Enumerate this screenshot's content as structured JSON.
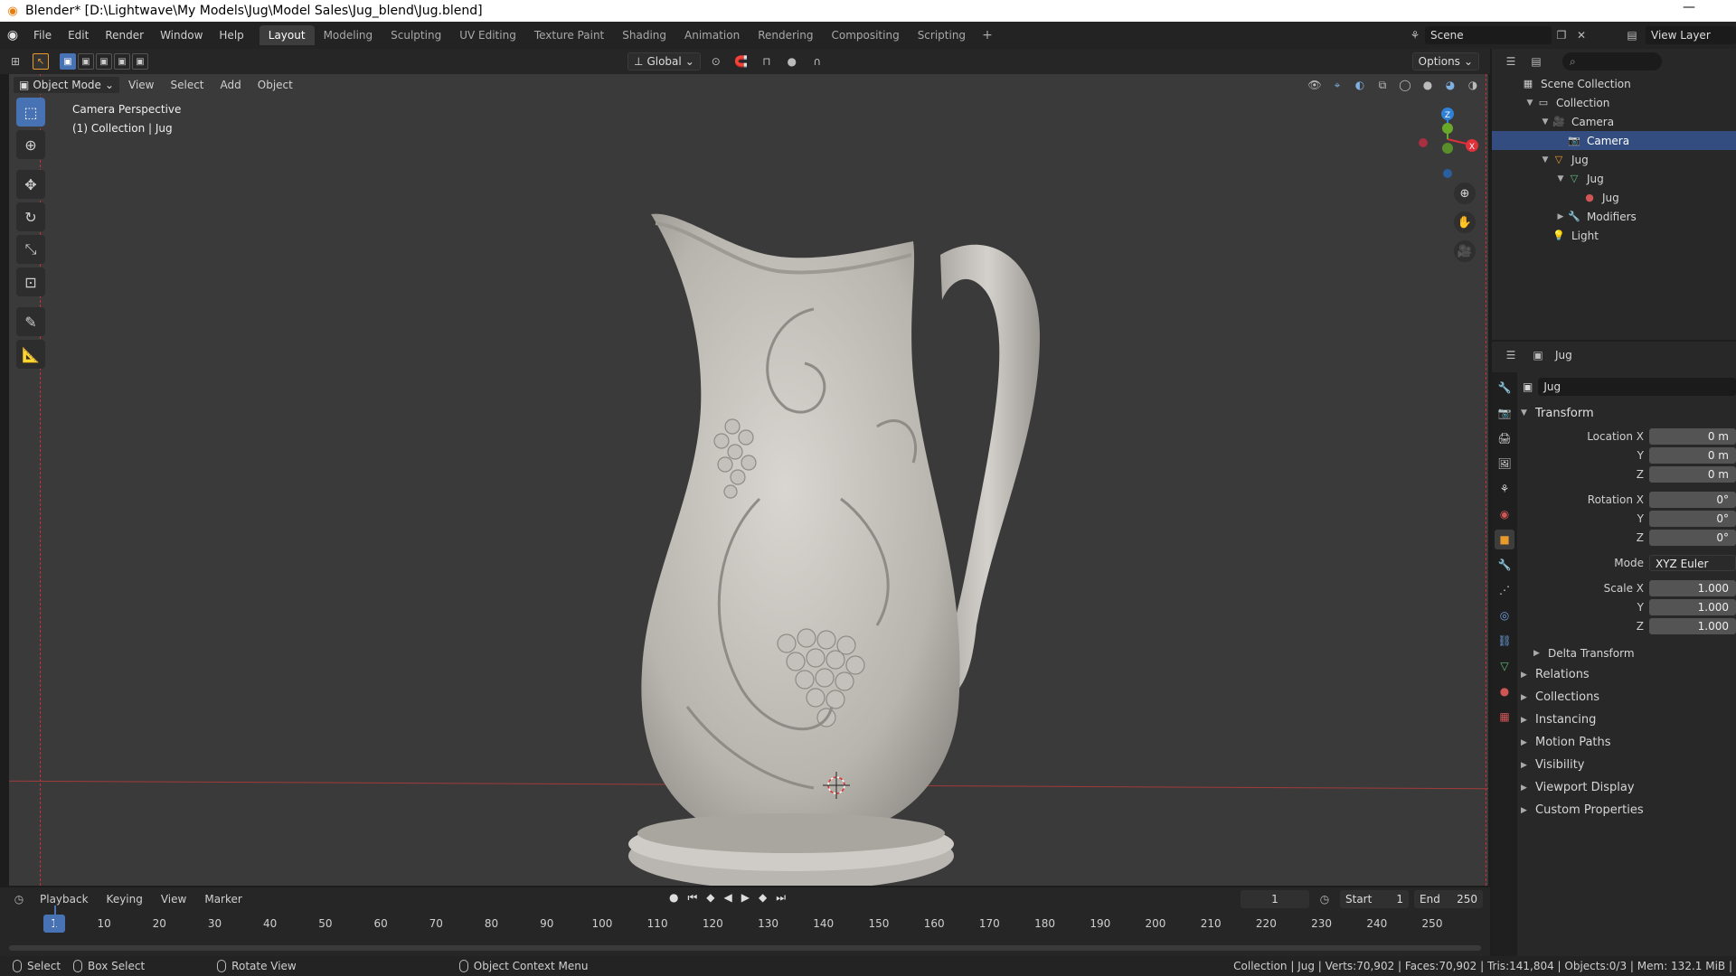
{
  "titlebar": {
    "title": "Blender* [D:\\Lightwave\\My Models\\Jug\\Model Sales\\Jug_blend\\Jug.blend]",
    "minimize": "—"
  },
  "menu": [
    "File",
    "Edit",
    "Render",
    "Window",
    "Help"
  ],
  "workspaces": [
    {
      "label": "Layout",
      "active": true
    },
    {
      "label": "Modeling"
    },
    {
      "label": "Sculpting"
    },
    {
      "label": "UV Editing"
    },
    {
      "label": "Texture Paint"
    },
    {
      "label": "Shading"
    },
    {
      "label": "Animation"
    },
    {
      "label": "Rendering"
    },
    {
      "label": "Compositing"
    },
    {
      "label": "Scripting"
    }
  ],
  "workspace_add": "+",
  "scene": {
    "label": "Scene",
    "view_layer": "View Layer"
  },
  "header2": {
    "orientation": "Global",
    "options": "Options"
  },
  "viewport": {
    "mode": "Object Mode",
    "menus": [
      "View",
      "Select",
      "Add",
      "Object"
    ],
    "overlay_line1": "Camera Perspective",
    "overlay_line2": "(1) Collection | Jug",
    "gizmo": {
      "x": "X",
      "y": "Y",
      "z": "Z"
    }
  },
  "timeline": {
    "menus": [
      "Playback",
      "Keying",
      "View",
      "Marker"
    ],
    "current_frame": "1",
    "start_label": "Start",
    "start": "1",
    "end_label": "End",
    "end": "250",
    "ticks": [
      "10",
      "20",
      "30",
      "40",
      "50",
      "60",
      "70",
      "80",
      "90",
      "100",
      "110",
      "120",
      "130",
      "140",
      "150",
      "160",
      "170",
      "180",
      "190",
      "200",
      "210",
      "220",
      "230",
      "240",
      "250"
    ],
    "cur": "1"
  },
  "statusbar": {
    "select": "Select",
    "box_select": "Box Select",
    "rotate": "Rotate View",
    "context": "Object Context Menu",
    "stats": "Collection | Jug | Verts:70,902 | Faces:70,902 | Tris:141,804 | Objects:0/3 | Mem: 132.1 MiB |"
  },
  "outliner": {
    "rows": [
      {
        "label": "Scene Collection",
        "indent": 0,
        "icon": "scene-collection-icon",
        "color": "#cfcfcf"
      },
      {
        "label": "Collection",
        "indent": 1,
        "icon": "collection-icon",
        "color": "#cfcfcf"
      },
      {
        "label": "Camera",
        "indent": 2,
        "icon": "camera-object-icon",
        "color": "#e89a2c"
      },
      {
        "label": "Camera",
        "indent": 3,
        "icon": "camera-data-icon",
        "color": "#7fb0e0",
        "selected": true
      },
      {
        "label": "Jug",
        "indent": 2,
        "icon": "mesh-object-icon",
        "color": "#e89a2c"
      },
      {
        "label": "Jug",
        "indent": 3,
        "icon": "mesh-data-icon",
        "color": "#5fbf7f"
      },
      {
        "label": "Jug",
        "indent": 4,
        "icon": "material-icon",
        "color": "#d05555"
      },
      {
        "label": "Modifiers",
        "indent": 3,
        "icon": "wrench-icon",
        "color": "#6ea0e0"
      },
      {
        "label": "Light",
        "indent": 2,
        "icon": "light-icon",
        "color": "#e89a2c"
      }
    ]
  },
  "properties": {
    "header_name": "Jug",
    "object_name": "Jug",
    "transform_title": "Transform",
    "location": {
      "label": "Location X",
      "x": "0 m",
      "y": "0 m",
      "z": "0 m"
    },
    "rotation": {
      "label": "Rotation X",
      "x": "0°",
      "y": "0°",
      "z": "0°"
    },
    "mode_label": "Mode",
    "mode": "XYZ Euler",
    "scale": {
      "label": "Scale X",
      "x": "1.000",
      "y": "1.000",
      "z": "1.000"
    },
    "axis_y": "Y",
    "axis_z": "Z",
    "delta": "Delta Transform",
    "panels": [
      "Relations",
      "Collections",
      "Instancing",
      "Motion Paths",
      "Visibility",
      "Viewport Display",
      "Custom Properties"
    ]
  },
  "colors": {
    "accent": "#4772b3",
    "orange": "#e89a2c",
    "x_axis": "#e0303a",
    "y_axis": "#6aa82a",
    "z_axis": "#2e80d8"
  }
}
